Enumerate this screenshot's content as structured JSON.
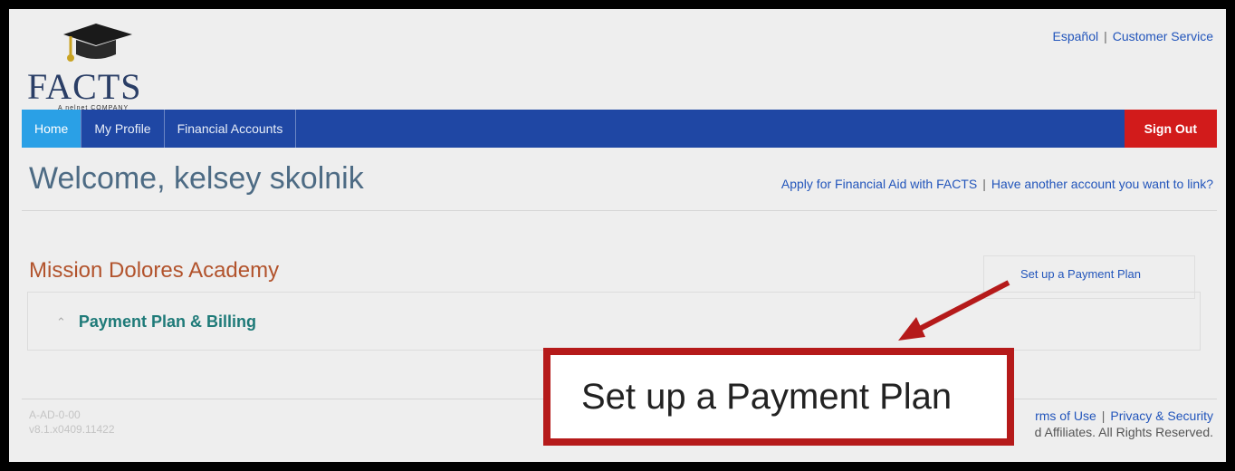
{
  "header": {
    "logo_text": "FACTS",
    "logo_subtext": "A nelnet COMPANY",
    "links": [
      "Español",
      "Customer Service"
    ]
  },
  "nav": {
    "items": [
      "Home",
      "My Profile",
      "Financial Accounts"
    ],
    "active": "Home",
    "sign_out": "Sign Out"
  },
  "welcome": {
    "title": "Welcome, kelsey skolnik",
    "links": [
      "Apply for Financial Aid with FACTS",
      "Have another account you want to link?"
    ]
  },
  "school": {
    "name": "Mission Dolores Academy",
    "setup_link": "Set up a Payment Plan",
    "section": "Payment Plan & Billing"
  },
  "footer": {
    "left_line1": "A-AD-0-00",
    "left_line2": "v8.1.x0409.11422",
    "links": [
      "rms of Use",
      "Privacy & Security"
    ],
    "copyright": "d Affiliates. All Rights Reserved."
  },
  "callout": {
    "text": "Set up a Payment Plan",
    "color": "#b51a1a"
  }
}
